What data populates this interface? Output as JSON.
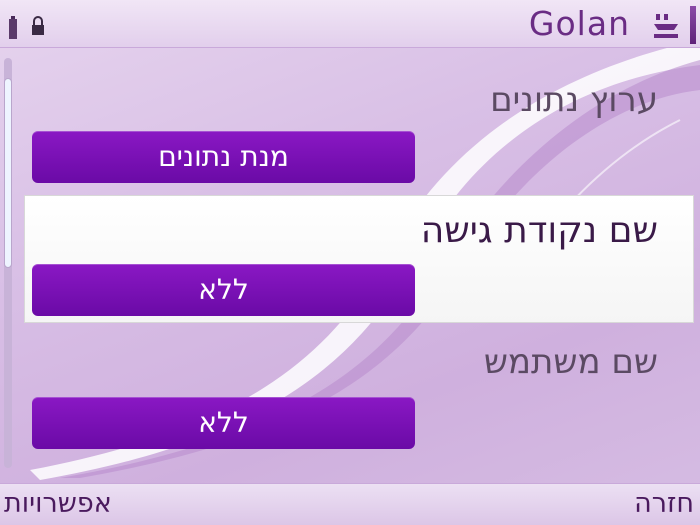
{
  "status_bar": {
    "operator": "Golan",
    "battery_icon": "battery-icon",
    "lock_icon": "keypad-lock-icon",
    "signal_icon": "signal-icon"
  },
  "settings": [
    {
      "label": "ערוץ נתונים",
      "value": "מנת נתונים",
      "selected": false
    },
    {
      "label": "שם נקודת גישה",
      "value": "ללא",
      "selected": true
    },
    {
      "label": "שם משתמש",
      "value": "ללא",
      "selected": false
    }
  ],
  "softkeys": {
    "left": "אפשרויות",
    "right": "חזרה"
  },
  "colors": {
    "accent": "#7a10b8",
    "background": "#d9c0e6",
    "operator_text": "#6a2c84"
  }
}
